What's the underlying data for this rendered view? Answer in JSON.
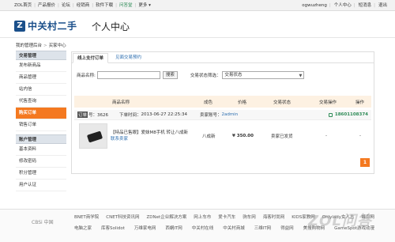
{
  "topnav": {
    "items": [
      "ZOL首页",
      "产品报价",
      "论坛",
      "经销商",
      "软件下载",
      "问答堂",
      "更多"
    ],
    "active_index": 5
  },
  "topright": {
    "username": "ogwuzheng",
    "links": [
      "个人中心",
      "短消息",
      "退出"
    ]
  },
  "header": {
    "logo_mark": "Z",
    "logo_text": "中关村二手",
    "page_title": "个人中心"
  },
  "breadcrumb": {
    "home": "我的管理后台",
    "current": "买家中心"
  },
  "sidebar": {
    "sections": [
      {
        "title": "交易管理",
        "items": [
          "发布新商品",
          "商品管理",
          "站内信",
          "代售查询",
          "购买订单",
          "销售订单"
        ],
        "active_index": 4
      },
      {
        "title": "账户管理",
        "items": [
          "基本资料",
          "修改密码",
          "积分管理",
          "用户认证"
        ]
      }
    ]
  },
  "tabs": [
    "线上支付订单",
    "见面交易预约"
  ],
  "filter": {
    "name_label": "商品名称:",
    "search_button": "搜索",
    "status_label": "交易状态筛选：",
    "status_value": "交易状态"
  },
  "table": {
    "headers": [
      "商品名称",
      "成色",
      "价格",
      "交易状态",
      "交易操作",
      "操作"
    ]
  },
  "order": {
    "tag": "订单",
    "number": "号：3626",
    "time_label": "下单时间：",
    "time": "2013-06-27 22:25:34",
    "seller_account_label": "卖家账号：",
    "seller_account": "2admin",
    "phone": "18601108374",
    "product_name": "【特品已售眼】爱妹M8手机 转让八成新",
    "contact_seller": "联系卖家",
    "condition": "八成新",
    "price": "¥ 350.00",
    "status": "卖家已发货",
    "action": "-",
    "operation": "-"
  },
  "pager": {
    "current": "1"
  },
  "footer": {
    "brand": "CBSi 中国",
    "links_row1": [
      "BNET商学院",
      "CNET科技资讯网",
      "ZDNet企业解决方案",
      "网上车市",
      "爱卡汽车",
      "驹车网",
      "海客时尚网",
      "KIDS家教网",
      "Onlylady女人志",
      "蜂鸟网"
    ],
    "links_row2": [
      "电脑之家",
      "库客Solidot",
      "万维家电网",
      "西蜗IT网",
      "中关村在线",
      "中关村商城",
      "三维IT网",
      "得益网",
      "美搜购物网",
      "GameSpot游戏动漫"
    ],
    "watermark": "ZOL问答"
  }
}
